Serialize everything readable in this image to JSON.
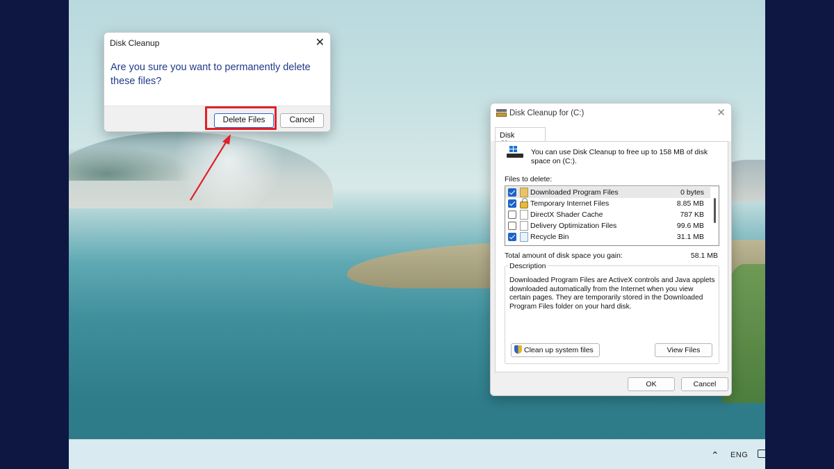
{
  "confirm_dialog": {
    "title": "Disk Cleanup",
    "message": "Are you sure you want to permanently delete these files?",
    "delete_label": "Delete Files",
    "cancel_label": "Cancel",
    "close_glyph": "✕"
  },
  "disk_cleanup": {
    "title": "Disk Cleanup for  (C:)",
    "close_glyph": "✕",
    "tab_label": "Disk Cleanup",
    "info_text": "You can use Disk Cleanup to free up to 158 MB of disk space on  (C:).",
    "files_label": "Files to delete:",
    "files": [
      {
        "name": "Downloaded Program Files",
        "size": "0 bytes",
        "checked": true,
        "icon": "folder-icon",
        "selected": true
      },
      {
        "name": "Temporary Internet Files",
        "size": "8.85 MB",
        "checked": true,
        "icon": "lock-icon",
        "selected": false
      },
      {
        "name": "DirectX Shader Cache",
        "size": "787 KB",
        "checked": false,
        "icon": "page-icon",
        "selected": false
      },
      {
        "name": "Delivery Optimization Files",
        "size": "99.6 MB",
        "checked": false,
        "icon": "page-icon",
        "selected": false
      },
      {
        "name": "Recycle Bin",
        "size": "31.1 MB",
        "checked": true,
        "icon": "recycle-bin-icon",
        "selected": false
      }
    ],
    "total_label": "Total amount of disk space you gain:",
    "total_value": "58.1 MB",
    "description_legend": "Description",
    "description_text": "Downloaded Program Files are ActiveX controls and Java applets downloaded automatically from the Internet when you view certain pages. They are temporarily stored in the Downloaded Program Files folder on your hard disk.",
    "cleanup_system_label": "Clean up system files",
    "view_files_label": "View Files",
    "ok_label": "OK",
    "cancel_label": "Cancel"
  },
  "taskbar": {
    "language": "ENG",
    "chevron_glyph": "⌃"
  },
  "colors": {
    "highlight": "#e0202a",
    "accent": "#1e63c6",
    "message_text": "#1f3b8a"
  }
}
